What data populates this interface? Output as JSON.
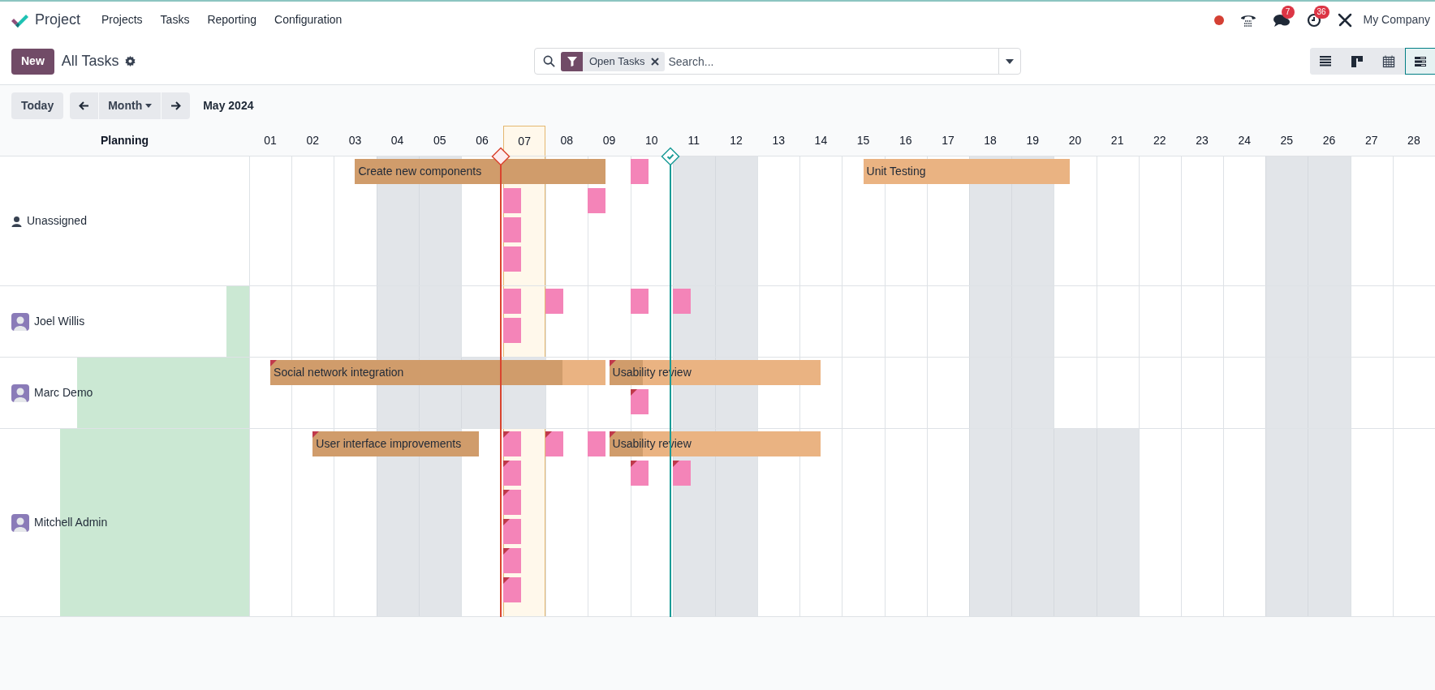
{
  "app": {
    "name": "Project",
    "menu": [
      "Projects",
      "Tasks",
      "Reporting",
      "Configuration"
    ]
  },
  "systray": {
    "chat_count": "7",
    "activity_count": "36",
    "company": "My Company"
  },
  "control_panel": {
    "new_button": "New",
    "title": "All Tasks",
    "facet": "Open Tasks",
    "search": {
      "placeholder": "Search..."
    },
    "views": [
      {
        "kind": "list",
        "selected": false
      },
      {
        "kind": "kanban",
        "selected": false
      },
      {
        "kind": "calendar",
        "selected": false
      },
      {
        "kind": "gantt",
        "selected": true
      }
    ]
  },
  "toolbar": {
    "today": "Today",
    "scale": "Month",
    "period": "May 2024"
  },
  "gantt": {
    "header": "Planning",
    "days": [
      {
        "label": "01",
        "today": false
      },
      {
        "label": "02",
        "today": false
      },
      {
        "label": "03",
        "today": false
      },
      {
        "label": "04",
        "today": false
      },
      {
        "label": "05",
        "today": false
      },
      {
        "label": "06",
        "today": false
      },
      {
        "label": "07",
        "today": true
      },
      {
        "label": "08",
        "today": false
      },
      {
        "label": "09",
        "today": false
      },
      {
        "label": "10",
        "today": false
      },
      {
        "label": "11",
        "today": false
      },
      {
        "label": "12",
        "today": false
      },
      {
        "label": "13",
        "today": false
      },
      {
        "label": "14",
        "today": false
      },
      {
        "label": "15",
        "today": false
      },
      {
        "label": "16",
        "today": false
      },
      {
        "label": "17",
        "today": false
      },
      {
        "label": "18",
        "today": false
      },
      {
        "label": "19",
        "today": false
      },
      {
        "label": "20",
        "today": false
      },
      {
        "label": "21",
        "today": false
      },
      {
        "label": "22",
        "today": false
      },
      {
        "label": "23",
        "today": false
      },
      {
        "label": "24",
        "today": false
      },
      {
        "label": "25",
        "today": false
      },
      {
        "label": "26",
        "today": false
      },
      {
        "label": "27",
        "today": false
      },
      {
        "label": "28",
        "today": false
      }
    ],
    "markers": [
      {
        "kind": "deadline",
        "reached": false
      },
      {
        "kind": "milestone",
        "reached": true
      }
    ],
    "rows": [
      {
        "name": "Unassigned",
        "kind": "unassigned",
        "unavailable": [
          false,
          false,
          false,
          true,
          true,
          false,
          false,
          false,
          false,
          false,
          true,
          true,
          false,
          false,
          false,
          false,
          false,
          true,
          true,
          false,
          false,
          false,
          false,
          false,
          true,
          true,
          false,
          false
        ],
        "lanes": [
          [
            {
              "name": "Create new components",
              "color": "#d09c6b",
              "overdue": false
            },
            {
              "color": "#f484b8",
              "overdue": false
            },
            {
              "name": "Unit Testing",
              "color": "#eab382",
              "overdue": false
            }
          ],
          [
            {
              "color": "#f484b8",
              "overdue": false
            },
            {
              "color": "#f484b8",
              "overdue": false
            }
          ],
          [
            {
              "color": "#f484b8",
              "overdue": false
            }
          ],
          [
            {
              "color": "#f484b8",
              "overdue": false
            }
          ]
        ]
      },
      {
        "name": "Joel Willis",
        "kind": "person",
        "level": 0.09,
        "unavailable": [
          false,
          false,
          false,
          true,
          true,
          false,
          false,
          false,
          false,
          false,
          true,
          true,
          false,
          false,
          false,
          false,
          false,
          true,
          true,
          false,
          false,
          false,
          false,
          false,
          true,
          true,
          false,
          false
        ],
        "lanes": [
          [
            {
              "color": "#f484b8",
              "overdue": false
            },
            {
              "color": "#f484b8",
              "overdue": false
            },
            {
              "color": "#f484b8",
              "overdue": false
            },
            {
              "color": "#f484b8",
              "overdue": false
            }
          ],
          [
            {
              "color": "#f484b8",
              "overdue": false
            }
          ]
        ]
      },
      {
        "name": "Marc Demo",
        "kind": "person",
        "level": 0.69,
        "unavailable": [
          false,
          false,
          false,
          true,
          true,
          true,
          true,
          false,
          false,
          false,
          true,
          true,
          false,
          false,
          false,
          false,
          false,
          true,
          true,
          false,
          false,
          false,
          false,
          false,
          true,
          true,
          false,
          false
        ],
        "lanes": [
          [
            {
              "name": "Social network integration",
              "color": "#eab382",
              "level": 0.87,
              "overdue": true
            },
            {
              "name": "Usability review",
              "color": "#eab382",
              "level": 0.16,
              "overdue": true
            }
          ],
          [
            {
              "color": "#f484b8",
              "overdue": true
            }
          ]
        ]
      },
      {
        "name": "Mitchell Admin",
        "kind": "person",
        "level": 0.76,
        "unavailable": [
          false,
          false,
          false,
          true,
          true,
          false,
          false,
          false,
          false,
          false,
          true,
          true,
          false,
          false,
          false,
          false,
          false,
          true,
          true,
          true,
          true,
          false,
          false,
          false,
          true,
          true,
          false,
          false
        ],
        "lanes": [
          [
            {
              "name": "User interface improvements",
              "color": "#d09c6b",
              "overdue": true
            },
            {
              "color": "#f484b8",
              "overdue": true
            },
            {
              "color": "#f484b8",
              "overdue": true
            },
            {
              "color": "#f484b8",
              "overdue": false
            },
            {
              "name": "Usability review",
              "color": "#eab382",
              "level": 0.16,
              "overdue": true
            }
          ],
          [
            {
              "color": "#f484b8",
              "overdue": true
            },
            {
              "color": "#f484b8",
              "overdue": true
            },
            {
              "color": "#f484b8",
              "overdue": true
            }
          ],
          [
            {
              "color": "#f484b8",
              "overdue": true
            }
          ],
          [
            {
              "color": "#f484b8",
              "overdue": true
            }
          ],
          [
            {
              "color": "#f484b8",
              "overdue": true
            }
          ],
          [
            {
              "color": "#f484b8",
              "overdue": true
            }
          ]
        ]
      }
    ]
  }
}
